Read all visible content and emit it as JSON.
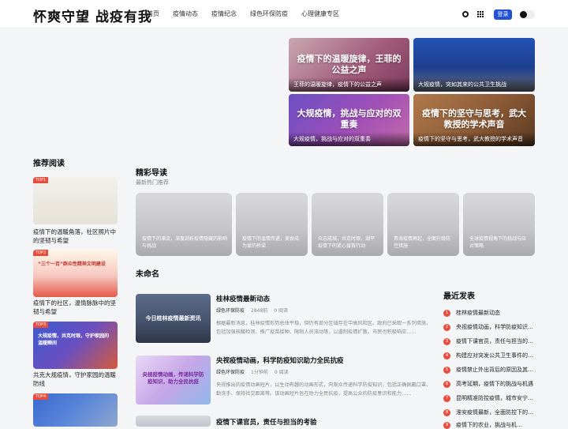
{
  "header": {
    "logo": "怀爽守望 战疫有我",
    "nav": [
      "首页",
      "疫情动态",
      "疫情纪念",
      "绿色环保防疫",
      "心理健康专区"
    ],
    "login": "登录"
  },
  "heroes": [
    {
      "big": "疫情下的温暖旋律，王菲的公益之声",
      "caption": "王菲的温暖旋律，疫情下的公益之声"
    },
    {
      "big": "",
      "caption": "大规疫情，突如其来的公共卫生挑战"
    },
    {
      "big": "大规疫情，挑战与应对的双重奏",
      "caption": "大规疫情，挑战与应对的双重奏"
    },
    {
      "big": "疫情下的坚守与思考，武大教授的学术声音",
      "caption": "疫情下的坚守与思考，武大教授的学术声音"
    }
  ],
  "recommend": {
    "title": "推荐阅读",
    "items": [
      {
        "tag": "TOP1",
        "inner": "",
        "title": "疫情下的温暖角落，社区照片中的坚韧与希望"
      },
      {
        "tag": "TOP2",
        "inner": "“三个一百”群众性精神文明建设",
        "title": "疫情下的社区，温情脉脉中的坚韧与希望"
      },
      {
        "tag": "TOP3",
        "inner": "大规疫情，共克时艰，守护家园的温暖瞬间",
        "title": "共克大规疫情，守护家园的温暖防线"
      },
      {
        "tag": "TOP4",
        "inner": "",
        "title": ""
      }
    ]
  },
  "featured": {
    "title": "精彩导读",
    "subtitle": "最新热门推荐",
    "cards": [
      "疫情下的凛流，深度剖析疫情隐藏的影响与挑战",
      "疫情下的温情传递，美食成为爱的桥梁",
      "众志成城，共克时艰，湖平疫情下的紧心援救行动",
      "青海疫情再起，全面升级防控措施",
      "全球疫情视角下的挑战与应对策略"
    ]
  },
  "unnamed": {
    "title": "未命名",
    "articles": [
      {
        "title": "桂林疫情最新动态",
        "author": "绿色环保防疫",
        "time": "2848前",
        "reads": "0 阅读",
        "excerpt": "根据最新消息，桂林疫情形势总体平稳，但仍有部分区域存在中高风险区。政府已采取一系列措施，包括加强核酸检测、推广疫苗接种、限制人员流动等，以遏制疫情扩散。市民也积极响应……",
        "img_text": "今日桂林疫情最新资讯"
      },
      {
        "title": "央视疫情动画，科学防疫知识助力全民抗疫",
        "author": "绿色环保防疫",
        "time": "1分钟前",
        "reads": "0 阅读",
        "excerpt": "央视推出的疫情动画短片，以生动有趣的动画形式，向观众传递科学防疫知识，包括正确佩戴口罩、勤洗手、保持社交距离等。该动画短片旨在助力全民抗疫，提高公众的防疫意识和能力……",
        "img_text": "央视疫情动画，传递科学防疫知识，助力全民抗疫"
      },
      {
        "title": "疫情下课官员，责任与担当的考验",
        "author": "",
        "time": "",
        "reads": "",
        "excerpt": "",
        "img_text": ""
      }
    ]
  },
  "latest": {
    "title": "最近发表",
    "items": [
      "桂林疫情最新动态",
      "央视疫情动画，科学防疫知识...",
      "疫情下课官员，责任与担当的...",
      "构建应对突发公共卫生事件的...",
      "疫情禁止外出背后的原因及其...",
      "高考延期，疫情下的挑战与机遇",
      "昆明精准防控疫情，城市安宁...",
      "淮安疫情最新，全面防控下的...",
      "疫情下的农业，挑战与机..."
    ]
  },
  "colors": {
    "accent": "#2151d6",
    "badge": "#e74c3c"
  }
}
